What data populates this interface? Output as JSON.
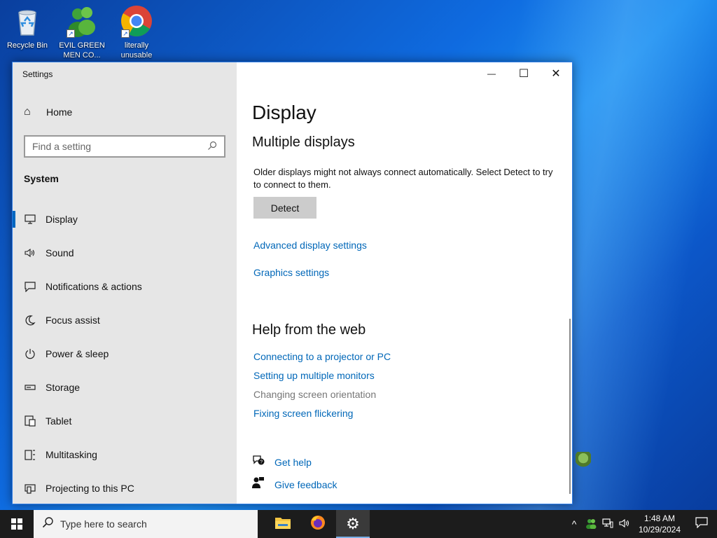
{
  "desktop": {
    "icons": [
      {
        "label": "Recycle Bin"
      },
      {
        "label": "EVIL GREEN MEN CO..."
      },
      {
        "label": "literally unusable"
      }
    ]
  },
  "window": {
    "title": "Settings",
    "minimize_icon": "—",
    "maximize_icon": "☐",
    "close_icon": "✕"
  },
  "sidebar": {
    "home_label": "Home",
    "search_placeholder": "Find a setting",
    "section_label": "System",
    "items": [
      {
        "label": "Display",
        "icon": "monitor-icon",
        "active": true
      },
      {
        "label": "Sound",
        "icon": "speaker-icon"
      },
      {
        "label": "Notifications & actions",
        "icon": "notification-icon"
      },
      {
        "label": "Focus assist",
        "icon": "moon-icon"
      },
      {
        "label": "Power & sleep",
        "icon": "power-icon"
      },
      {
        "label": "Storage",
        "icon": "storage-icon"
      },
      {
        "label": "Tablet",
        "icon": "tablet-icon"
      },
      {
        "label": "Multitasking",
        "icon": "multitasking-icon"
      },
      {
        "label": "Projecting to this PC",
        "icon": "projecting-icon"
      }
    ]
  },
  "content": {
    "page_title": "Display",
    "multiple_displays_heading": "Multiple displays",
    "description": "Older displays might not always connect automatically. Select Detect to try to connect to them.",
    "detect_label": "Detect",
    "advanced_link": "Advanced display settings",
    "graphics_link": "Graphics settings",
    "help_heading": "Help from the web",
    "help_links": [
      "Connecting to a projector or PC",
      "Setting up multiple monitors",
      "Changing screen orientation",
      "Fixing screen flickering"
    ],
    "get_help": "Get help",
    "give_feedback": "Give feedback"
  },
  "taskbar": {
    "search_placeholder": "Type here to search",
    "time": "1:48 AM",
    "date": "10/29/2024"
  },
  "colors": {
    "accent": "#0067b8",
    "sidebar_bg": "#e6e6e6",
    "taskbar_bg": "#1c1c1c"
  }
}
